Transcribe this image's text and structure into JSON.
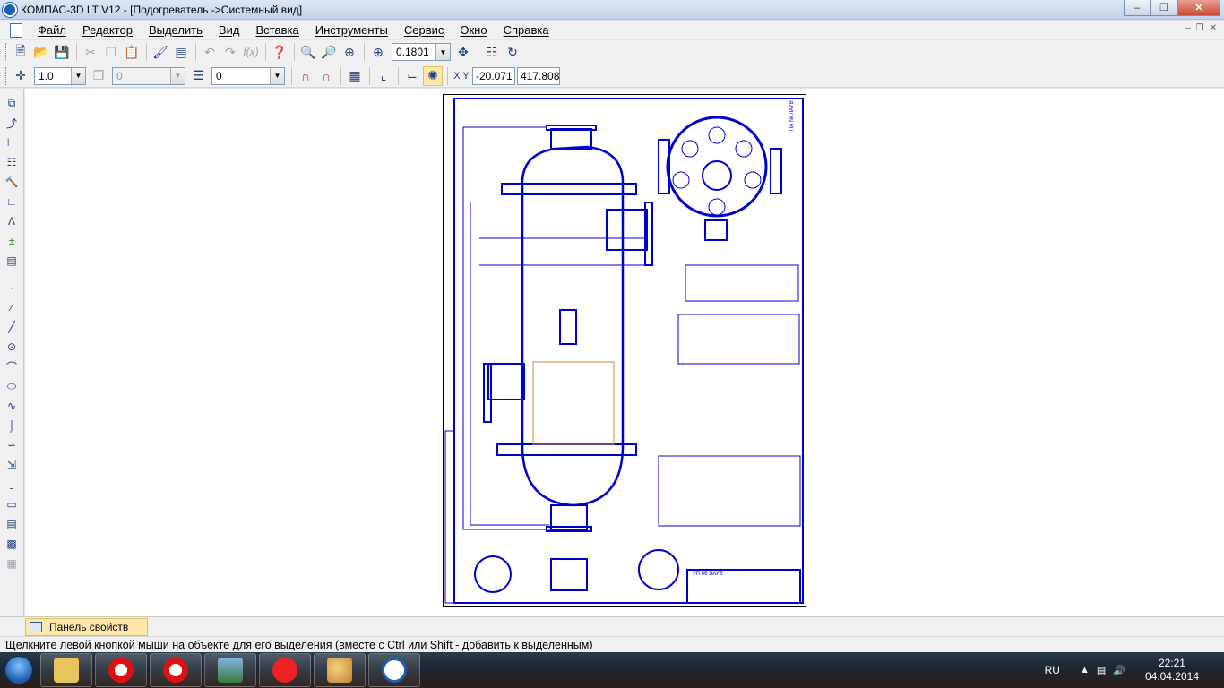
{
  "window": {
    "title": "КОМПАС-3D LT V12 - [Подогреватель ->Системный вид]"
  },
  "menu": {
    "items": [
      "Файл",
      "Редактор",
      "Выделить",
      "Вид",
      "Вставка",
      "Инструменты",
      "Сервис",
      "Окно",
      "Справка"
    ]
  },
  "toolbar1": {
    "zoom_value": "0.1801"
  },
  "toolbar2": {
    "line_width": "1.0",
    "layer_disabled": "0",
    "layer": "0",
    "coord_x": "-20.071",
    "coord_y": "417.808"
  },
  "properties_panel": {
    "tab_label": "Панель свойств"
  },
  "status": {
    "message": "Щелкните левой кнопкой мыши на объекте для его выделения (вместе с Ctrl или Shift - добавить к выделенным)"
  },
  "taskbar": {
    "lang": "RU",
    "time": "22:21",
    "date": "04.04.2014"
  },
  "drawing": {
    "stamp_code": "УП 06 ЛАУВ",
    "corner_code": "ПА № ЛАУВ",
    "colors": {
      "lines": "#0000cc",
      "tubes": "#d9822b"
    }
  }
}
